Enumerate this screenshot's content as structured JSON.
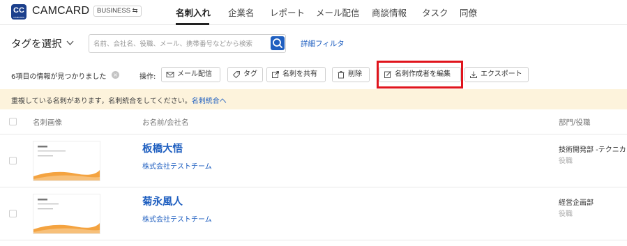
{
  "header": {
    "logo_text": "CC",
    "logo_sub": "CAMCARD",
    "brand": "CAMCARD",
    "badge": "BUSINESS ⇆",
    "tabs": [
      {
        "label": "名刺入れ",
        "active": true
      },
      {
        "label": "企業名",
        "active": false
      },
      {
        "label": "レポート",
        "active": false
      },
      {
        "label": "メール配信",
        "active": false
      },
      {
        "label": "商談情報",
        "active": false
      },
      {
        "label": "タスク",
        "active": false
      },
      {
        "label": "同僚",
        "active": false
      }
    ]
  },
  "filter": {
    "tag_select_label": "タグを選択",
    "search_placeholder": "名前、会社名、役職、メール、携帯番号などから検索",
    "detail_filter": "詳細フィルタ"
  },
  "actions": {
    "found_text": "6項目の情報が見つかりました",
    "op_label": "操作:",
    "buttons": [
      {
        "label": "メール配信",
        "icon": "mail-icon"
      },
      {
        "label": "タグ",
        "icon": "tag-icon"
      },
      {
        "label": "名刺を共有",
        "icon": "share-icon"
      },
      {
        "label": "削除",
        "icon": "trash-icon"
      },
      {
        "label": "名刺作成者を編集",
        "icon": "edit-icon"
      },
      {
        "label": "エクスポート",
        "icon": "export-icon"
      }
    ]
  },
  "notice": {
    "text": "重複している名刺があります，名刺統合をしてください。",
    "link": "名刺統合へ"
  },
  "table": {
    "columns": [
      "名刺画像",
      "お名前/会社名",
      "部門/役職"
    ],
    "rows": [
      {
        "name": "板橋大悟",
        "company": "株式会社テストチーム",
        "department": "技術開発部 -テクニカ",
        "title": "役職"
      },
      {
        "name": "菊永風人",
        "company": "株式会社テストチーム",
        "department": "経営企画部",
        "title": "役職"
      }
    ]
  },
  "colors": {
    "accent": "#1f5fc0",
    "brand": "#1b3f8c",
    "highlight": "#e0141c",
    "notice_bg": "#fdf3dc"
  }
}
